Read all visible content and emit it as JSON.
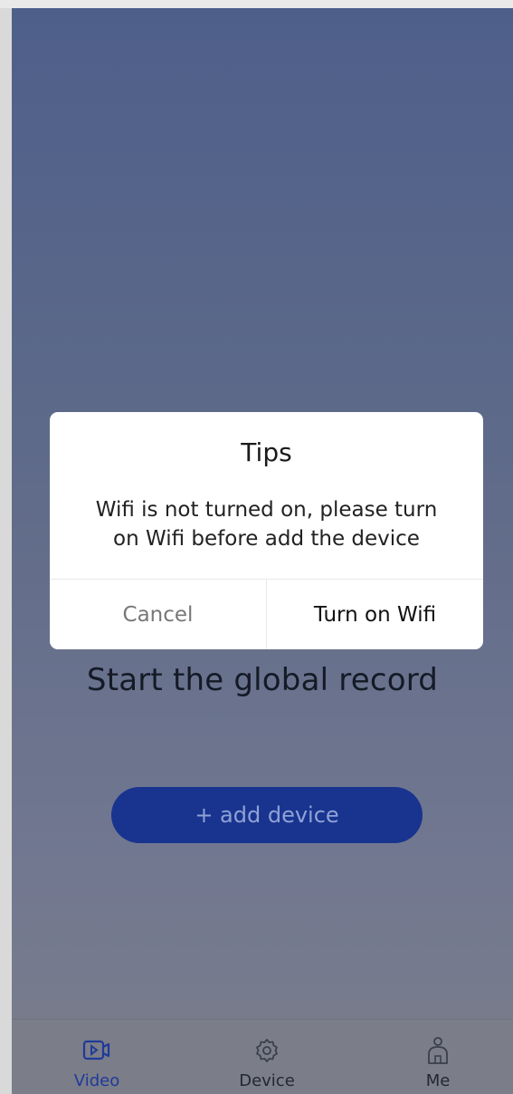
{
  "main": {
    "headline": "Start the global record",
    "add_device_label": "+ add device"
  },
  "dialog": {
    "title": "Tips",
    "message_line1": "Wifi is not turned on, please turn",
    "message_line2": "on Wifi before add the device",
    "cancel_label": "Cancel",
    "confirm_label": "Turn on Wifi"
  },
  "tabbar": {
    "items": [
      {
        "label": "Video",
        "icon": "video-icon",
        "active": true
      },
      {
        "label": "Device",
        "icon": "gear-icon",
        "active": false
      },
      {
        "label": "Me",
        "icon": "person-icon",
        "active": false
      }
    ]
  },
  "colors": {
    "accent": "#1f3a9a",
    "button": "#19348f",
    "overlay_top": "#4e5f8a",
    "overlay_bottom": "#7a7d8a"
  }
}
